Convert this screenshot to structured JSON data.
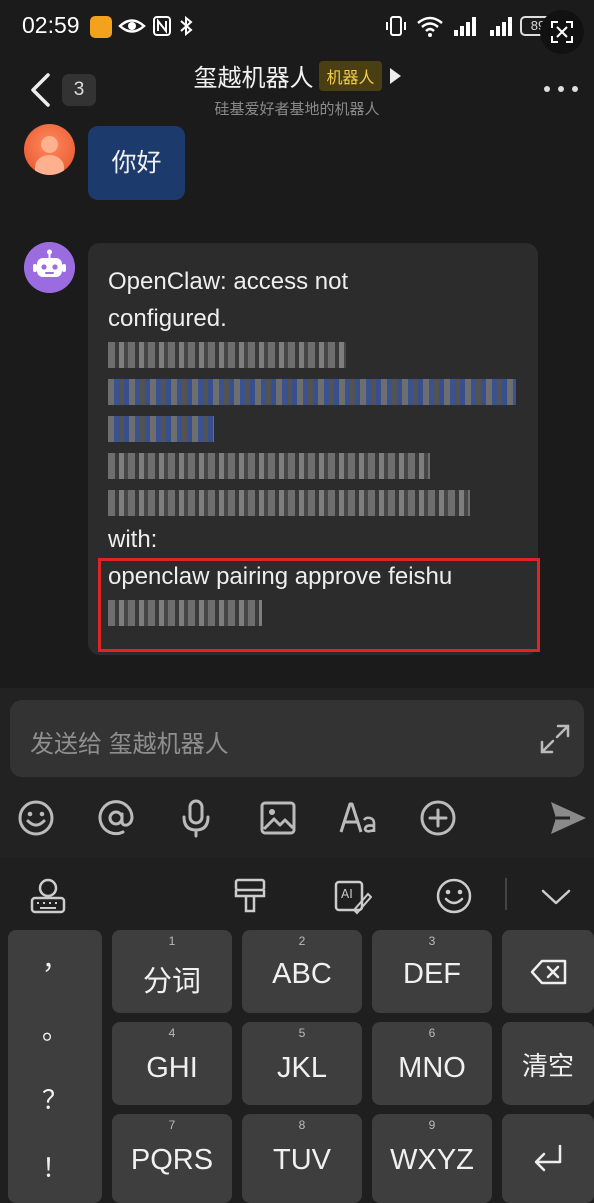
{
  "status_bar": {
    "time": "02:59",
    "battery": "89",
    "icons": [
      "app-icon",
      "eye-icon",
      "nfc-icon",
      "bluetooth-icon",
      "vibrate-icon",
      "wifi-icon",
      "signal-icon",
      "signal-icon",
      "battery-icon",
      "screenshot-icon"
    ]
  },
  "header": {
    "unread_count": "3",
    "title": "玺越机器人",
    "tag": "机器人",
    "subtitle": "硅基爱好者基地的机器人"
  },
  "messages": {
    "user_text": "你好",
    "bot_line1": "OpenClaw: access not",
    "bot_line2": "configured.",
    "bot_with": "with:",
    "bot_command": "openclaw pairing approve feishu"
  },
  "composer": {
    "placeholder": "发送给 玺越机器人",
    "tools": [
      "emoji-icon",
      "mention-icon",
      "microphone-icon",
      "image-icon",
      "text-format-icon",
      "add-icon",
      "send-icon"
    ]
  },
  "keyboard": {
    "toolbar": [
      "keyboard-settings-icon",
      "brush-icon",
      "ai-edit-icon",
      "emoji-icon",
      "collapse-icon"
    ],
    "punctuation": [
      "，",
      "。",
      "？",
      "！"
    ],
    "keys": [
      {
        "num": "1",
        "label": "分词"
      },
      {
        "num": "2",
        "label": "ABC"
      },
      {
        "num": "3",
        "label": "DEF"
      },
      {
        "num": "4",
        "label": "GHI"
      },
      {
        "num": "5",
        "label": "JKL"
      },
      {
        "num": "6",
        "label": "MNO"
      },
      {
        "num": "7",
        "label": "PQRS"
      },
      {
        "num": "8",
        "label": "TUV"
      },
      {
        "num": "9",
        "label": "WXYZ"
      }
    ],
    "clear_label": "清空"
  }
}
